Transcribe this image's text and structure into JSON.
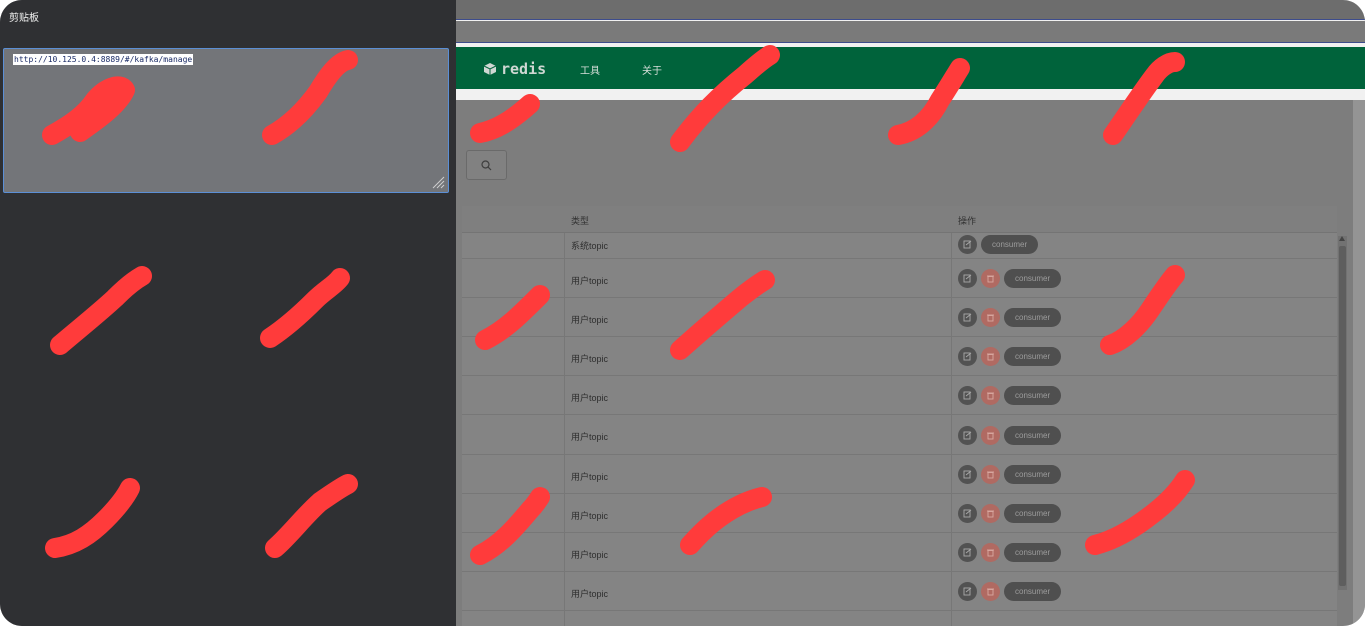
{
  "clipboard": {
    "title": "剪贴板",
    "content": "http://10.125.0.4:8889/#/kafka/manage"
  },
  "app": {
    "logo_text": "redis",
    "nav": {
      "tools": "工具",
      "about": "关于"
    },
    "table": {
      "columns": {
        "type": "类型",
        "ops": "操作"
      },
      "rows": [
        {
          "type": "系统topic",
          "deletable": false,
          "consumer": "consumer"
        },
        {
          "type": "用户topic",
          "deletable": true,
          "consumer": "consumer"
        },
        {
          "type": "用户topic",
          "deletable": true,
          "consumer": "consumer"
        },
        {
          "type": "用户topic",
          "deletable": true,
          "consumer": "consumer"
        },
        {
          "type": "用户topic",
          "deletable": true,
          "consumer": "consumer"
        },
        {
          "type": "用户topic",
          "deletable": true,
          "consumer": "consumer"
        },
        {
          "type": "用户topic",
          "deletable": true,
          "consumer": "consumer"
        },
        {
          "type": "用户topic",
          "deletable": true,
          "consumer": "consumer"
        },
        {
          "type": "用户topic",
          "deletable": true,
          "consumer": "consumer"
        },
        {
          "type": "用户topic",
          "deletable": true,
          "consumer": "consumer"
        }
      ]
    }
  },
  "colors": {
    "navbar": "#00633b",
    "clipboard_bg": "#2f3033",
    "redaction": "#ff3b3b",
    "delete_button": "#b06a62"
  },
  "icons": {
    "logo": "cube-icon",
    "search": "search-icon",
    "edit": "edit-icon",
    "delete": "trash-icon",
    "resize": "resize-grip-icon"
  }
}
